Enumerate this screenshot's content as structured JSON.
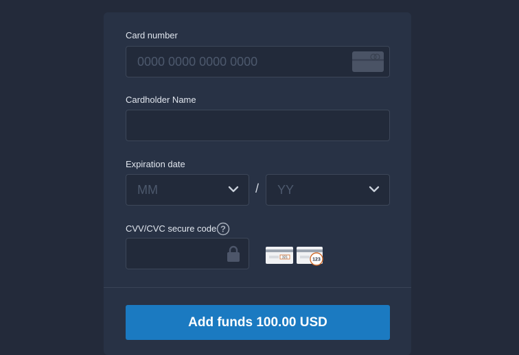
{
  "form": {
    "card_number": {
      "label": "Card number",
      "placeholder": "0000 0000 0000 0000",
      "icon": "credit-card-icon"
    },
    "cardholder": {
      "label": "Cardholder Name",
      "value": ""
    },
    "expiration": {
      "label": "Expiration date",
      "month_placeholder": "MM",
      "year_placeholder": "YY",
      "separator": "/"
    },
    "cvv": {
      "label": "CVV/CVC secure code",
      "help_icon": "question-circle-icon",
      "lock_icon": "lock-icon",
      "hint_card_front": "321",
      "hint_card_back": "123"
    },
    "submit_label": "Add funds 100.00 USD"
  },
  "colors": {
    "background": "#232a3a",
    "panel": "#283245",
    "field": "#222a3a",
    "accent": "#1b7ac1"
  }
}
